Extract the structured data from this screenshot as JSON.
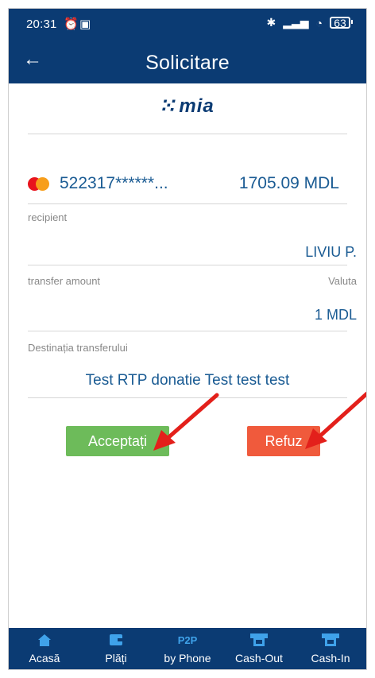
{
  "status_bar": {
    "time": "20:31",
    "battery": "63"
  },
  "header": {
    "title": "Solicitare"
  },
  "brand": {
    "logo_text": "mia"
  },
  "card": {
    "number": "522317******...",
    "balance": "1705.09 MDL"
  },
  "recipient": {
    "label": "recipient",
    "value": "LIVIU P."
  },
  "amount": {
    "label": "transfer amount",
    "currency_label": "Valuta",
    "value": "1 MDL"
  },
  "purpose": {
    "label": "Destinația transferului",
    "value": "Test RTP donatie Test test test"
  },
  "actions": {
    "accept_label": "Acceptați",
    "refuse_label": "Refuz"
  },
  "bottom_nav": {
    "items": [
      {
        "label": "Acasă",
        "icon": "home-icon"
      },
      {
        "label": "Plăți",
        "icon": "wallet-icon"
      },
      {
        "label": "by Phone",
        "icon_text": "P2P"
      },
      {
        "label": "Cash-Out",
        "icon": "atm-out-icon"
      },
      {
        "label": "Cash-In",
        "icon": "atm-in-icon"
      }
    ]
  },
  "colors": {
    "primary": "#0b3b73",
    "text_blue": "#1a5b93",
    "accept": "#6dbb5a",
    "refuse": "#f05a3c",
    "arrow": "#e3201b",
    "nav_icon": "#3fa2ea"
  }
}
